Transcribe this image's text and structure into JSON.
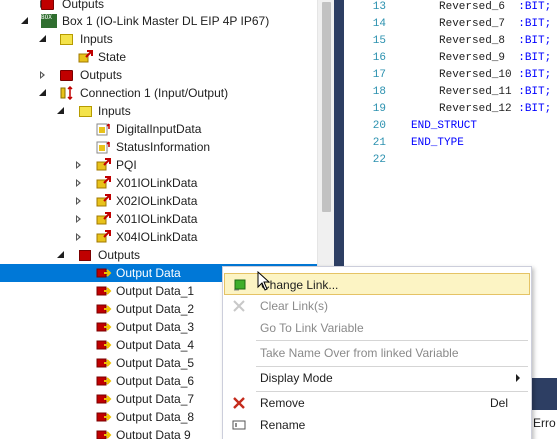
{
  "tree": {
    "rows": [
      {
        "label": "Outputs"
      },
      {
        "label": "Box 1 (IO-Link Master DL EIP 4P IP67)",
        "icon_text": "BOX"
      },
      {
        "label": "Inputs"
      },
      {
        "label": "State"
      },
      {
        "label": "Outputs"
      },
      {
        "label": "Connection 1 (Input/Output)"
      },
      {
        "label": "Inputs"
      },
      {
        "label": "DigitalInputData"
      },
      {
        "label": "StatusInformation"
      },
      {
        "label": "PQI"
      },
      {
        "label": "X01IOLinkData"
      },
      {
        "label": "X02IOLinkData"
      },
      {
        "label": "X01IOLinkData"
      },
      {
        "label": "X04IOLinkData"
      },
      {
        "label": "Outputs"
      },
      {
        "label": "Output Data",
        "selected": true
      },
      {
        "label": "Output Data_1"
      },
      {
        "label": "Output Data_2"
      },
      {
        "label": "Output Data_3"
      },
      {
        "label": "Output Data_4"
      },
      {
        "label": "Output Data_5"
      },
      {
        "label": "Output Data_6"
      },
      {
        "label": "Output Data_7"
      },
      {
        "label": "Output Data_8"
      },
      {
        "label": "Output Data 9"
      }
    ]
  },
  "code": {
    "lines": [
      {
        "num": "13",
        "text": "Reversed_6  :BIT;"
      },
      {
        "num": "14",
        "text": "Reversed_7  :BIT;"
      },
      {
        "num": "15",
        "text": "Reversed_8  :BIT;"
      },
      {
        "num": "16",
        "text": "Reversed_9  :BIT;"
      },
      {
        "num": "17",
        "text": "Reversed_10 :BIT;"
      },
      {
        "num": "18",
        "text": "Reversed_11 :BIT;"
      },
      {
        "num": "19",
        "text": "Reversed_12 :BIT;"
      },
      {
        "num": "20",
        "text": "END_STRUCT"
      },
      {
        "num": "21",
        "text": "END_TYPE"
      },
      {
        "num": "22",
        "text": ""
      }
    ],
    "error_tab": "0 Erro"
  },
  "context_menu": {
    "items": [
      {
        "label": "Change Link...",
        "icon": "change-link-icon"
      },
      {
        "label": "Clear Link(s)",
        "icon": "clear-links-icon"
      },
      {
        "label": "Go To Link Variable"
      },
      {
        "label": "Take Name Over from linked Variable"
      },
      {
        "label": "Display Mode"
      },
      {
        "label": "Remove",
        "shortcut": "Del",
        "icon": "remove-icon"
      },
      {
        "label": "Rename",
        "icon": "rename-icon"
      }
    ]
  },
  "colors": {
    "selection": "#0078d7",
    "menu_hot": "#fcf4c4",
    "keyword": "#0000ff",
    "line_number": "#2b91af",
    "divider": "#2d3e63"
  }
}
